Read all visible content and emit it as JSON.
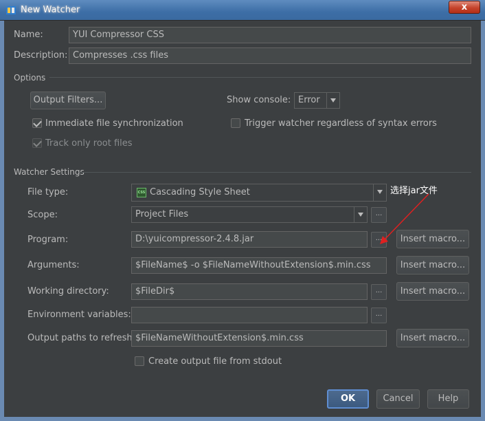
{
  "window": {
    "title": "New Watcher",
    "close_glyph": "x"
  },
  "name": {
    "label": "Name:",
    "value": "YUI Compressor CSS"
  },
  "description": {
    "label": "Description:",
    "value": "Compresses .css files"
  },
  "options": {
    "section": "Options",
    "output_filters": "Output Filters...",
    "show_console_label": "Show console:",
    "show_console_value": "Error",
    "immediate_sync": "Immediate file synchronization",
    "trigger_watcher": "Trigger watcher regardless of syntax errors",
    "track_root": "Track only root files"
  },
  "watcher": {
    "section": "Watcher Settings",
    "file_type_label": "File type:",
    "file_type_value": "Cascading Style Sheet",
    "file_type_icon_text": "CSS",
    "scope_label": "Scope:",
    "scope_value": "Project Files",
    "program_label": "Program:",
    "program_value": "D:\\yuicompressor-2.4.8.jar",
    "arguments_label": "Arguments:",
    "arguments_value": "$FileName$ -o $FileNameWithoutExtension$.min.css",
    "workdir_label": "Working directory:",
    "workdir_value": "$FileDir$",
    "env_label": "Environment variables:",
    "env_value": "",
    "output_paths_label": "Output paths to refresh:",
    "output_paths_value": "$FileNameWithoutExtension$.min.css",
    "create_output": "Create output file from stdout",
    "insert_macro": "Insert macro...",
    "browse": "..."
  },
  "annotation": {
    "text": "选择jar文件",
    "color": "#e02020"
  },
  "buttons": {
    "ok": "OK",
    "cancel": "Cancel",
    "help": "Help"
  }
}
